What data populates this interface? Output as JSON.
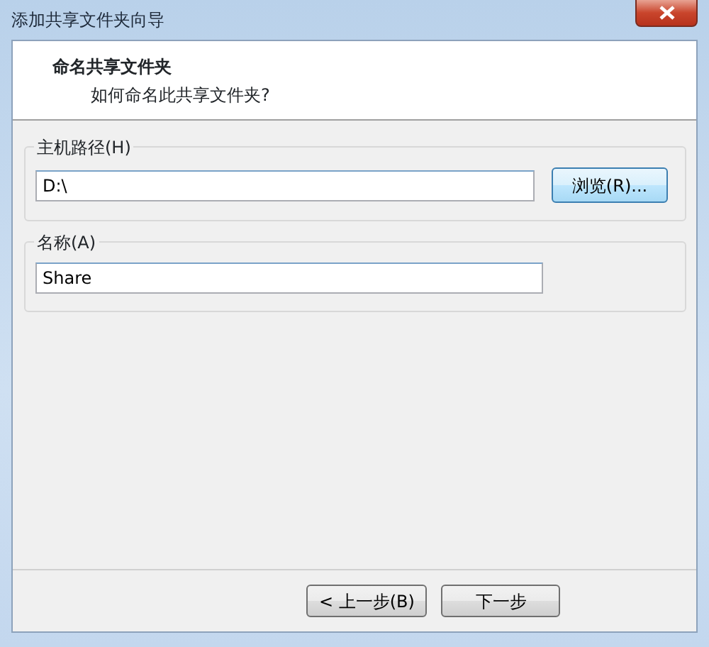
{
  "window": {
    "title": "添加共享文件夹向导"
  },
  "header": {
    "title": "命名共享文件夹",
    "subtitle": "如何命名此共享文件夹?"
  },
  "groups": [
    {
      "legend": "主机路径(H)",
      "value": "D:\\",
      "button": "浏览(R)..."
    },
    {
      "legend": "名称(A)",
      "value": "Share"
    }
  ],
  "buttons": [
    "< 上一步(B)",
    "下一步"
  ]
}
